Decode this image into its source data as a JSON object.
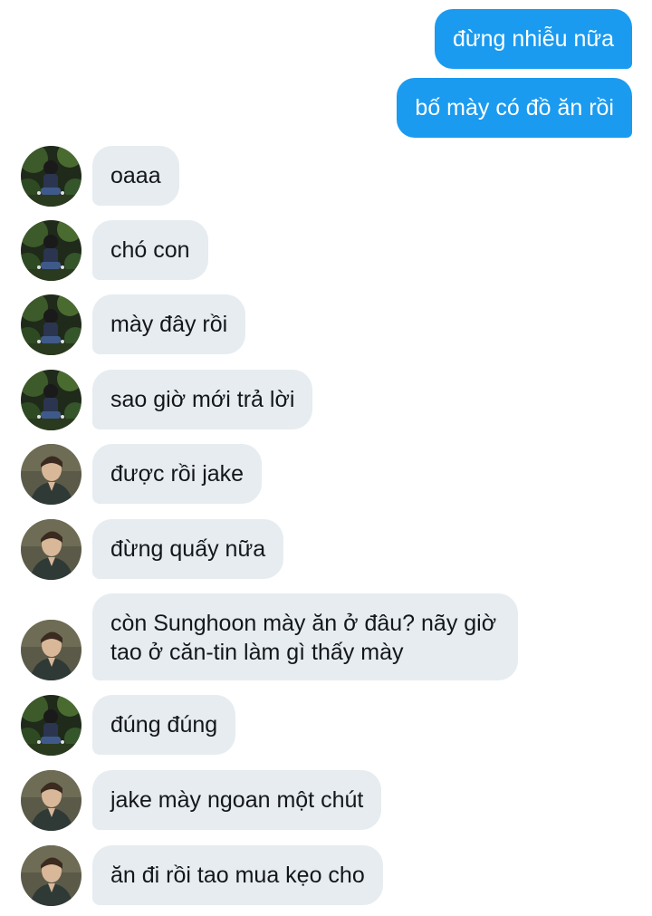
{
  "messages": [
    {
      "sender": "me",
      "text": "đừng nhiễu nữa"
    },
    {
      "sender": "me",
      "text": "bố mày có đồ ăn rồi"
    },
    {
      "sender": "jake",
      "avatar": "avatar-dark-forest",
      "text": "oaaa"
    },
    {
      "sender": "jake",
      "avatar": "avatar-dark-forest",
      "text": "chó con"
    },
    {
      "sender": "jake",
      "avatar": "avatar-dark-forest",
      "text": "mày đây rồi"
    },
    {
      "sender": "jake",
      "avatar": "avatar-dark-forest",
      "text": "sao giờ mới trả lời"
    },
    {
      "sender": "sunghoon",
      "avatar": "avatar-portrait",
      "text": "được rồi jake"
    },
    {
      "sender": "sunghoon",
      "avatar": "avatar-portrait",
      "text": "đừng quấy nữa"
    },
    {
      "sender": "sunghoon",
      "avatar": "avatar-portrait",
      "text": "còn Sunghoon mày ăn ở đâu? nãy giờ tao ở căn-tin làm gì thấy mày"
    },
    {
      "sender": "jake",
      "avatar": "avatar-dark-forest",
      "text": "đúng đúng"
    },
    {
      "sender": "sunghoon",
      "avatar": "avatar-portrait",
      "text": "jake mày ngoan một chút"
    },
    {
      "sender": "sunghoon",
      "avatar": "avatar-portrait",
      "text": "ăn đi rồi tao mua kẹo cho"
    }
  ],
  "colors": {
    "outgoing_bubble": "#1a9bf0",
    "incoming_bubble": "#e6ecf0",
    "incoming_text": "#14171a"
  }
}
